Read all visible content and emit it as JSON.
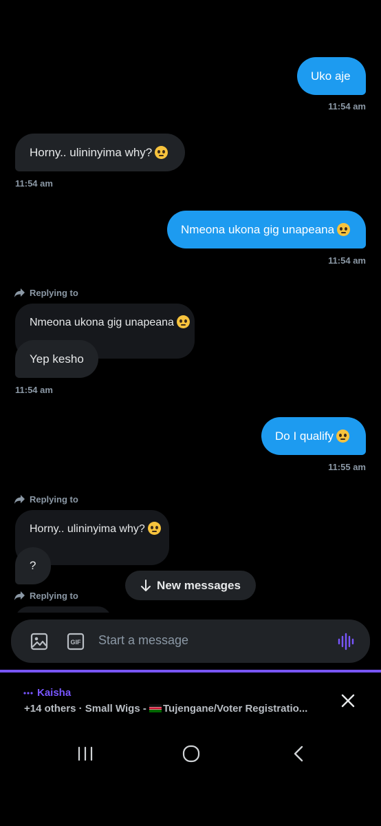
{
  "messages": {
    "m1": {
      "text": "Uko aje",
      "time": "11:54 am"
    },
    "m2": {
      "text": "Horny.. ulininyima why?",
      "time": "11:54 am"
    },
    "m3": {
      "text": "Nmeona ukona gig unapeana",
      "time": "11:54 am"
    },
    "m4": {
      "replying_label": "Replying to",
      "quoted": "Nmeona ukona gig unapeana",
      "text": "Yep kesho",
      "time": "11:54 am"
    },
    "m5": {
      "text": "Do I qualify",
      "time": "11:55 am"
    },
    "m6": {
      "replying_label": "Replying to",
      "quoted": "Horny.. ulininyima why?",
      "text": "?"
    },
    "m7": {
      "replying_label": "Replying to"
    }
  },
  "new_messages_label": "New messages",
  "composer": {
    "placeholder": "Start a message",
    "gif_label": "GIF"
  },
  "space": {
    "host": "Kaisha",
    "subtitle_prefix": "+14 others · Small Wigs - ",
    "subtitle_suffix": "Tujengane/Voter Registratio..."
  },
  "colors": {
    "accent": "#1d9bf0",
    "space": "#7856ff",
    "bubble_recv": "#202327"
  }
}
